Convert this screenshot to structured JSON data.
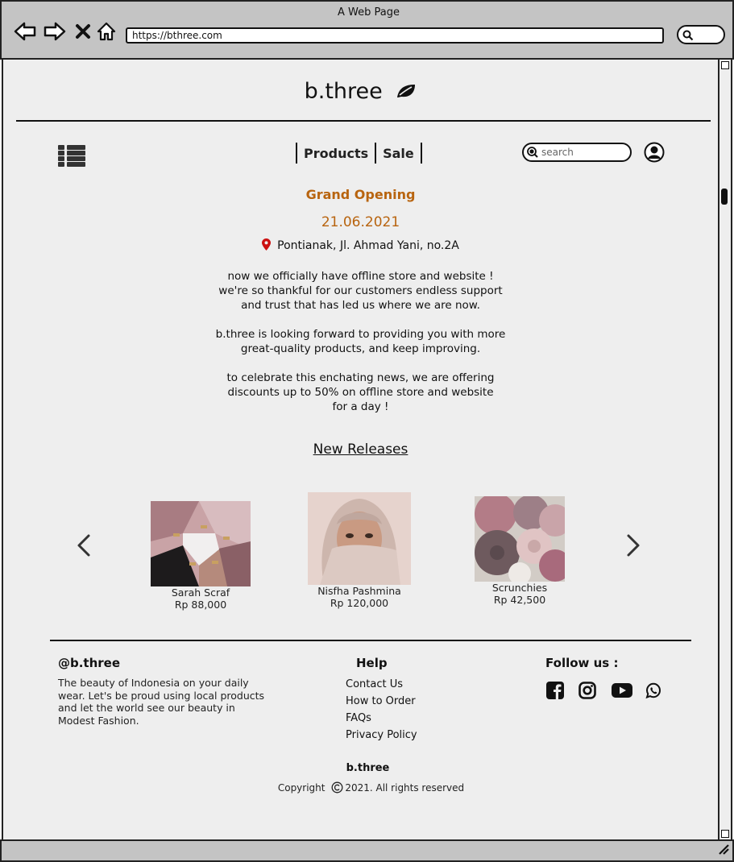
{
  "window": {
    "title": "A Web Page",
    "url": "https://bthree.com"
  },
  "header": {
    "brand": "b.three"
  },
  "nav": {
    "items": [
      "Products",
      "Sale"
    ],
    "search_placeholder": "search"
  },
  "announcement": {
    "title": "Grand Opening",
    "date": "21.06.2021",
    "location": "Pontianak, Jl. Ahmad Yani, no.2A",
    "para1": [
      "now we officially have offline store and website !",
      "we're so thankful for our customers endless support",
      "and trust that has led us where we are now."
    ],
    "para2": [
      "b.three is looking forward to providing you with more",
      "great-quality products, and keep improving."
    ],
    "para3": [
      "to celebrate this enchating news, we are offering",
      "discounts up to 50% on offline store and website",
      "for a day !"
    ]
  },
  "new_releases": {
    "heading": "New Releases",
    "products": [
      {
        "name": "Sarah Scraf",
        "price": "Rp 88,000"
      },
      {
        "name": "Nisfha Pashmina",
        "price": "Rp 120,000"
      },
      {
        "name": "Scrunchies",
        "price": "Rp 42,500"
      }
    ]
  },
  "footer": {
    "brand_handle": "@b.three",
    "description": "The beauty of Indonesia on your daily wear. Let's be proud using local products and let the world see our beauty in Modest Fashion.",
    "help": {
      "title": "Help",
      "links": [
        "Contact Us",
        "How to Order",
        "FAQs",
        "Privacy Policy"
      ]
    },
    "follow": {
      "title": "Follow us :",
      "icons": [
        "facebook-icon",
        "instagram-icon",
        "youtube-icon",
        "whatsapp-icon"
      ]
    },
    "brand": "b.three",
    "copyright_prefix": "Copyright",
    "copyright_suffix": "2021. All rights reserved"
  },
  "colors": {
    "accent": "#b8640f",
    "background": "#eeeeee",
    "chrome": "#c4c4c4",
    "pin": "#cc1111"
  }
}
